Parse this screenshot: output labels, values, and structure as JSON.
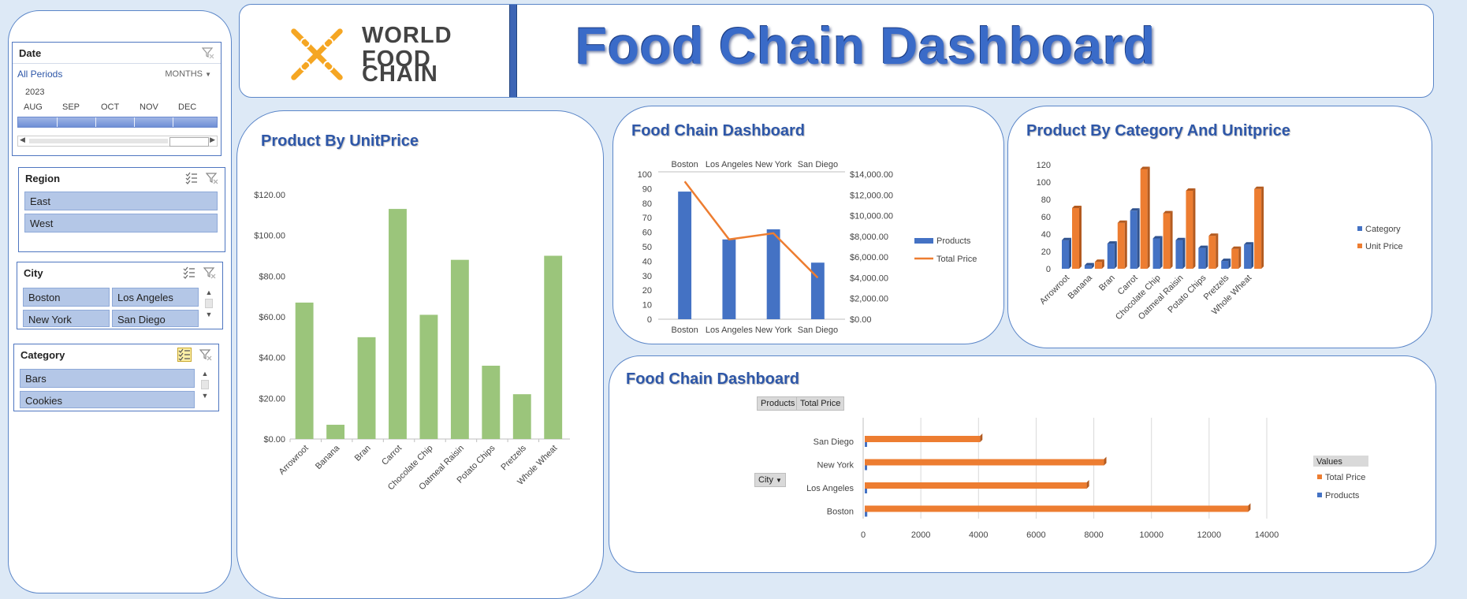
{
  "header": {
    "logo_line1": "WORLD",
    "logo_line2": "FOOD",
    "logo_line3": "CHAIN",
    "title": "Food Chain Dashboard"
  },
  "slicers": {
    "date": {
      "title": "Date",
      "all_periods": "All Periods",
      "level": "MONTHS",
      "year": "2023",
      "months": [
        "AUG",
        "SEP",
        "OCT",
        "NOV",
        "DEC"
      ]
    },
    "region": {
      "title": "Region",
      "items": [
        "East",
        "West"
      ]
    },
    "city": {
      "title": "City",
      "items": [
        "Boston",
        "Los Angeles",
        "New York",
        "San Diego"
      ]
    },
    "category": {
      "title": "Category",
      "items": [
        "Bars",
        "Cookies"
      ]
    }
  },
  "colors": {
    "green": "#9bc57b",
    "blue": "#4472c4",
    "orange": "#ed7d31",
    "title_blue": "#2e57a8"
  },
  "chart_data": [
    {
      "id": "unit_price",
      "type": "bar",
      "title": "Product By UnitPrice",
      "categories": [
        "Arrowroot",
        "Banana",
        "Bran",
        "Carrot",
        "Chocolate Chip",
        "Oatmeal Raisin",
        "Potato Chips",
        "Pretzels",
        "Whole Wheat"
      ],
      "values": [
        67,
        7,
        50,
        113,
        61,
        88,
        36,
        22,
        90
      ],
      "yticks": [
        "$0.00",
        "$20.00",
        "$40.00",
        "$60.00",
        "$80.00",
        "$100.00",
        "$120.00"
      ],
      "ylim": [
        0,
        120
      ]
    },
    {
      "id": "city_combo",
      "type": "bar",
      "title": "Food Chain Dashboard",
      "categories": [
        "Boston",
        "Los Angeles",
        "New York",
        "San Diego"
      ],
      "series": [
        {
          "name": "Products",
          "type": "bar",
          "values": [
            88,
            55,
            62,
            39
          ]
        },
        {
          "name": "Total Price",
          "type": "line",
          "values": [
            13300,
            7700,
            8300,
            4000
          ]
        }
      ],
      "yticks": [
        "0",
        "10",
        "20",
        "30",
        "40",
        "50",
        "60",
        "70",
        "80",
        "90",
        "100"
      ],
      "y2ticks": [
        "$0.00",
        "$2,000.00",
        "$4,000.00",
        "$6,000.00",
        "$8,000.00",
        "$10,000.00",
        "$12,000.00",
        "$14,000.00"
      ],
      "ylim": [
        0,
        100
      ],
      "y2lim": [
        0,
        14000
      ]
    },
    {
      "id": "category_unit",
      "type": "bar",
      "title": "Product By Category And Unitprice",
      "categories": [
        "Arrowroot",
        "Banana",
        "Bran",
        "Carrot",
        "Chocolate Chip",
        "Oatmeal Raisin",
        "Potato Chips",
        "Pretzels",
        "Whole Wheat"
      ],
      "series": [
        {
          "name": "Category",
          "values": [
            33,
            4,
            29,
            67,
            35,
            33,
            24,
            9,
            28
          ]
        },
        {
          "name": "Unit Price",
          "values": [
            70,
            8,
            53,
            115,
            64,
            90,
            38,
            23,
            92
          ]
        }
      ],
      "yticks": [
        "0",
        "20",
        "40",
        "60",
        "80",
        "100",
        "120"
      ],
      "ylim": [
        0,
        120
      ]
    },
    {
      "id": "city_bar",
      "type": "bar",
      "title": "Food Chain Dashboard",
      "categories": [
        "San Diego",
        "New York",
        "Los Angeles",
        "Boston"
      ],
      "series": [
        {
          "name": "Products",
          "values": [
            39,
            62,
            55,
            88
          ]
        },
        {
          "name": "Total Price",
          "values": [
            4000,
            8300,
            7700,
            13300
          ]
        }
      ],
      "xticks": [
        "0",
        "2000",
        "4000",
        "6000",
        "8000",
        "10000",
        "12000",
        "14000"
      ],
      "xlim": [
        0,
        14000
      ],
      "buttons": [
        "Products",
        "Total Price"
      ],
      "field_button": "City",
      "legend_title": "Values",
      "legend_items": [
        "Total Price",
        "Products"
      ]
    }
  ]
}
